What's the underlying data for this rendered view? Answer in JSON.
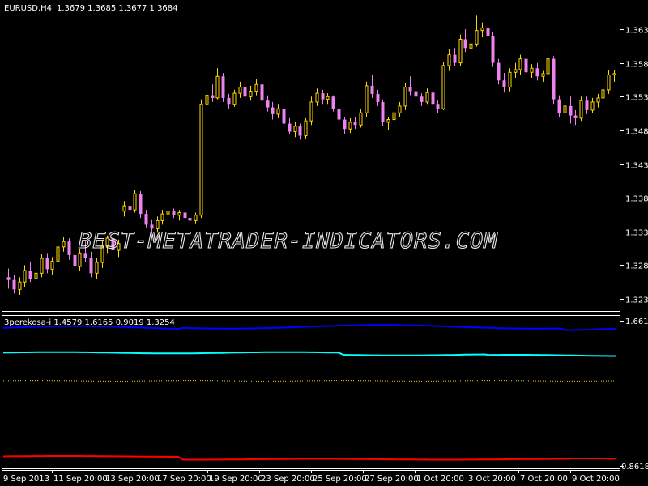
{
  "main_chart": {
    "symbol_label": "EURUSD,H4",
    "ohlc_label": "1.3679 1.3685 1.3677 1.3684",
    "price_ticks": [
      "1.3630",
      "1.3580",
      "1.3530",
      "1.3480",
      "1.3430",
      "1.3380",
      "1.3330",
      "1.3280",
      "1.3230"
    ],
    "bull_color": "#ffd700",
    "bear_color": "#ee82ee",
    "candles": [
      [
        1.3262,
        1.3275,
        1.3245,
        1.3258
      ],
      [
        1.3258,
        1.3266,
        1.3238,
        1.3244
      ],
      [
        1.3244,
        1.3262,
        1.3236,
        1.3255
      ],
      [
        1.3255,
        1.328,
        1.3248,
        1.3272
      ],
      [
        1.3272,
        1.3284,
        1.3255,
        1.326
      ],
      [
        1.326,
        1.3275,
        1.3248,
        1.3268
      ],
      [
        1.3268,
        1.3296,
        1.3262,
        1.329
      ],
      [
        1.329,
        1.3298,
        1.3268,
        1.3274
      ],
      [
        1.3274,
        1.3292,
        1.3266,
        1.3286
      ],
      [
        1.3286,
        1.3314,
        1.328,
        1.3307
      ],
      [
        1.3307,
        1.3322,
        1.33,
        1.3315
      ],
      [
        1.3315,
        1.332,
        1.3288,
        1.3295
      ],
      [
        1.3295,
        1.3302,
        1.327,
        1.3278
      ],
      [
        1.3278,
        1.3304,
        1.3272,
        1.3298
      ],
      [
        1.3298,
        1.3315,
        1.3285,
        1.329
      ],
      [
        1.329,
        1.33,
        1.3262,
        1.3268
      ],
      [
        1.3268,
        1.329,
        1.326,
        1.3284
      ],
      [
        1.3284,
        1.3316,
        1.3276,
        1.3308
      ],
      [
        1.3308,
        1.3324,
        1.3298,
        1.332
      ],
      [
        1.332,
        1.3325,
        1.3296,
        1.3302
      ],
      [
        1.3302,
        1.3318,
        1.3292,
        1.3312
      ],
      [
        1.336,
        1.3375,
        1.3352,
        1.3368
      ],
      [
        1.3368,
        1.3378,
        1.3352,
        1.3362
      ],
      [
        1.3362,
        1.3392,
        1.3358,
        1.3386
      ],
      [
        1.3386,
        1.339,
        1.335,
        1.3356
      ],
      [
        1.3356,
        1.3362,
        1.3336,
        1.334
      ],
      [
        1.334,
        1.3348,
        1.3326,
        1.3334
      ],
      [
        1.3334,
        1.3352,
        1.3328,
        1.3346
      ],
      [
        1.3346,
        1.3362,
        1.334,
        1.3356
      ],
      [
        1.3356,
        1.3366,
        1.335,
        1.336
      ],
      [
        1.336,
        1.3364,
        1.335,
        1.3354
      ],
      [
        1.3354,
        1.3362,
        1.3346,
        1.3358
      ],
      [
        1.3358,
        1.3362,
        1.3346,
        1.335
      ],
      [
        1.335,
        1.3358,
        1.3342,
        1.3346
      ],
      [
        1.3346,
        1.3358,
        1.3342,
        1.3354
      ],
      [
        1.3354,
        1.3526,
        1.335,
        1.3518
      ],
      [
        1.3518,
        1.3545,
        1.3512,
        1.3532
      ],
      [
        1.3532,
        1.3548,
        1.3522,
        1.3528
      ],
      [
        1.3528,
        1.3572,
        1.3526,
        1.356
      ],
      [
        1.356,
        1.3565,
        1.3522,
        1.3528
      ],
      [
        1.3528,
        1.3534,
        1.3512,
        1.3518
      ],
      [
        1.3518,
        1.354,
        1.3515,
        1.3535
      ],
      [
        1.3535,
        1.3552,
        1.3528,
        1.3544
      ],
      [
        1.3544,
        1.355,
        1.3522,
        1.353
      ],
      [
        1.353,
        1.3546,
        1.3524,
        1.3538
      ],
      [
        1.3538,
        1.3556,
        1.3532,
        1.3548
      ],
      [
        1.3548,
        1.3552,
        1.3518,
        1.3524
      ],
      [
        1.3524,
        1.3532,
        1.3508,
        1.3514
      ],
      [
        1.3514,
        1.3522,
        1.3496,
        1.3504
      ],
      [
        1.3504,
        1.3518,
        1.3498,
        1.3512
      ],
      [
        1.3512,
        1.3516,
        1.3484,
        1.349
      ],
      [
        1.349,
        1.3498,
        1.3474,
        1.3478
      ],
      [
        1.3478,
        1.3492,
        1.347,
        1.3486
      ],
      [
        1.3486,
        1.349,
        1.3466,
        1.3472
      ],
      [
        1.3472,
        1.3498,
        1.3468,
        1.3494
      ],
      [
        1.3494,
        1.353,
        1.3488,
        1.3522
      ],
      [
        1.3522,
        1.3542,
        1.3516,
        1.3535
      ],
      [
        1.3535,
        1.354,
        1.3518,
        1.3526
      ],
      [
        1.3526,
        1.3535,
        1.3518,
        1.353
      ],
      [
        1.353,
        1.3532,
        1.3508,
        1.3512
      ],
      [
        1.3512,
        1.3518,
        1.349,
        1.3496
      ],
      [
        1.3496,
        1.35,
        1.3474,
        1.3482
      ],
      [
        1.3482,
        1.3498,
        1.3476,
        1.3492
      ],
      [
        1.3492,
        1.35,
        1.3482,
        1.3488
      ],
      [
        1.3488,
        1.3512,
        1.3484,
        1.3506
      ],
      [
        1.3506,
        1.3552,
        1.35,
        1.3546
      ],
      [
        1.3546,
        1.3562,
        1.3528,
        1.3534
      ],
      [
        1.3534,
        1.354,
        1.3516,
        1.3522
      ],
      [
        1.3522,
        1.3526,
        1.3486,
        1.3492
      ],
      [
        1.3492,
        1.35,
        1.348,
        1.3496
      ],
      [
        1.3496,
        1.3512,
        1.349,
        1.3506
      ],
      [
        1.3506,
        1.3522,
        1.35,
        1.3516
      ],
      [
        1.3516,
        1.355,
        1.351,
        1.3544
      ],
      [
        1.3544,
        1.356,
        1.3532,
        1.3538
      ],
      [
        1.3538,
        1.3548,
        1.3526,
        1.353
      ],
      [
        1.353,
        1.3535,
        1.3516,
        1.3522
      ],
      [
        1.3522,
        1.3542,
        1.3518,
        1.3536
      ],
      [
        1.3536,
        1.3546,
        1.3512,
        1.3518
      ],
      [
        1.3518,
        1.3524,
        1.3506,
        1.3512
      ],
      [
        1.3512,
        1.3582,
        1.351,
        1.3576
      ],
      [
        1.3576,
        1.36,
        1.3568,
        1.3592
      ],
      [
        1.3592,
        1.3602,
        1.3575,
        1.358
      ],
      [
        1.358,
        1.3622,
        1.3576,
        1.3615
      ],
      [
        1.3615,
        1.363,
        1.3596,
        1.3602
      ],
      [
        1.3602,
        1.3615,
        1.359,
        1.3608
      ],
      [
        1.3608,
        1.365,
        1.3604,
        1.3628
      ],
      [
        1.3628,
        1.364,
        1.3618,
        1.3632
      ],
      [
        1.3632,
        1.3638,
        1.3616,
        1.362
      ],
      [
        1.362,
        1.3626,
        1.3574,
        1.358
      ],
      [
        1.358,
        1.3586,
        1.3548,
        1.3554
      ],
      [
        1.3554,
        1.3565,
        1.3536,
        1.3544
      ],
      [
        1.3544,
        1.3572,
        1.3538,
        1.3566
      ],
      [
        1.3566,
        1.358,
        1.3558,
        1.357
      ],
      [
        1.357,
        1.3592,
        1.3562,
        1.3586
      ],
      [
        1.3586,
        1.359,
        1.356,
        1.3566
      ],
      [
        1.3566,
        1.3578,
        1.3558,
        1.3572
      ],
      [
        1.3572,
        1.358,
        1.3554,
        1.356
      ],
      [
        1.356,
        1.3568,
        1.3552,
        1.3564
      ],
      [
        1.3564,
        1.3592,
        1.356,
        1.3586
      ],
      [
        1.3586,
        1.359,
        1.3518,
        1.3526
      ],
      [
        1.3526,
        1.3532,
        1.35,
        1.3506
      ],
      [
        1.3506,
        1.3522,
        1.3498,
        1.3516
      ],
      [
        1.3516,
        1.353,
        1.349,
        1.3502
      ],
      [
        1.3502,
        1.351,
        1.3488,
        1.3498
      ],
      [
        1.3498,
        1.353,
        1.3494,
        1.3524
      ],
      [
        1.3524,
        1.353,
        1.3504,
        1.351
      ],
      [
        1.351,
        1.3528,
        1.3506,
        1.3522
      ],
      [
        1.3522,
        1.3534,
        1.3514,
        1.3528
      ],
      [
        1.3528,
        1.3548,
        1.352,
        1.354
      ],
      [
        1.354,
        1.357,
        1.3534,
        1.3562
      ],
      [
        1.3562,
        1.357,
        1.3552,
        1.3564
      ]
    ]
  },
  "indicator": {
    "header": "3perekosa-i 1.4579 1.6165 0.9019 1.3254",
    "top_label": "1.661",
    "bottom_label": "0.8618",
    "line_colors": {
      "blue": "#0000ff",
      "cyan": "#00ffff",
      "dotted": "#ffd700",
      "red": "#ff0000"
    }
  },
  "time_axis": [
    "9 Sep 2013",
    "11 Sep 20:00",
    "13 Sep 20:00",
    "17 Sep 20:00",
    "19 Sep 20:00",
    "23 Sep 20:00",
    "25 Sep 20:00",
    "27 Sep 20:00",
    "1 Oct 20:00",
    "3 Oct 20:00",
    "7 Oct 20:00",
    "9 Oct 20:00"
  ],
  "watermark": "BEST-METATRADER-INDICATORS.COM"
}
